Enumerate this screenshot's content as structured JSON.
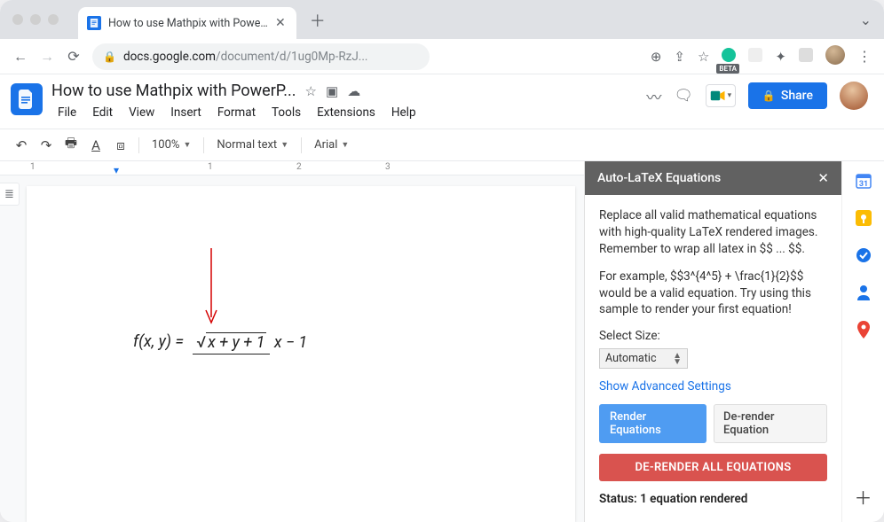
{
  "browser": {
    "tab_title": "How to use Mathpix with PowerP",
    "url_host": "docs.google.com",
    "url_path": "/document/d/1ug0Mp-RzJ...",
    "beta_badge": "BETA"
  },
  "docs": {
    "title": "How to use Mathpix with PowerP...",
    "menus": [
      "File",
      "Edit",
      "View",
      "Insert",
      "Format",
      "Tools",
      "Extensions",
      "Help"
    ],
    "share_label": "Share"
  },
  "toolbar": {
    "zoom": "100%",
    "style": "Normal text",
    "font": "Arial"
  },
  "ruler": {
    "marks": [
      "1",
      "1",
      "2",
      "3"
    ]
  },
  "equation": {
    "lhs": "f(x, y) =",
    "radicand": "x + y + 1",
    "den": "x − 1"
  },
  "addon": {
    "title": "Auto-LaTeX Equations",
    "p1": "Replace all valid mathematical equations with high-quality LaTeX rendered images. Remember to wrap all latex in $$ ... $$.",
    "p2": "For example, $$3^{4^5} + \\frac{1}{2}$$ would be a valid equation. Try using this sample to render your first equation!",
    "size_label": "Select Size:",
    "size_value": "Automatic",
    "advanced": "Show Advanced Settings",
    "render_btn": "Render Equations",
    "derender_btn": "De-render Equation",
    "derender_all": "DE-RENDER ALL EQUATIONS",
    "status": "Status: 1 equation rendered"
  },
  "sidepanel_icons": [
    "calendar",
    "keep",
    "tasks",
    "contacts",
    "maps"
  ]
}
